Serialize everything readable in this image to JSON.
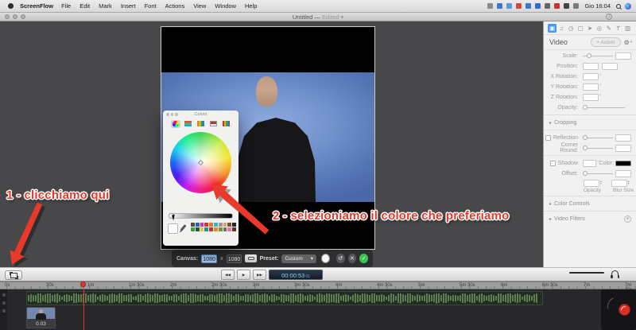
{
  "menu_bar": {
    "app_name": "ScreenFlow",
    "items": [
      "File",
      "Edit",
      "Mark",
      "Insert",
      "Font",
      "Actions",
      "View",
      "Window",
      "Help"
    ],
    "clock": "Gio 16:04",
    "status_icon_colors": [
      "#8a8a8a",
      "#3e77c9",
      "#5b9bd5",
      "#c94a3e",
      "#3e77c9",
      "#2f6fd0",
      "#666666",
      "#c0392b",
      "#444444",
      "#7a7a7a"
    ]
  },
  "title_bar": {
    "title": "Untitled —",
    "edited": "Edited"
  },
  "annotations": {
    "step1": "1 - clicchiamo qui",
    "step2": "2 - selezioniamo il colore che preferiamo"
  },
  "colors_panel": {
    "title": "Colors",
    "swatches_row1": [
      "#4d4d4d",
      "#2f5bb7",
      "#c23b9e",
      "#d63333",
      "#e2762d",
      "#39b3c8",
      "#9a9a9a",
      "#c8a87a",
      "#7a5236",
      "#262626"
    ],
    "swatches_row2": [
      "#3f9a42",
      "#1f5c2e",
      "#d8c93a",
      "#2e8b8b",
      "#b33636",
      "#d88c2e",
      "#8a8a2e",
      "#6f6f6f",
      "#d87ea8",
      "#5c2e2e"
    ]
  },
  "canvas_bar": {
    "canvas_label": "Canvas:",
    "width": "1080",
    "x_sep": "x",
    "height": "1080",
    "preset_label": "Preset:",
    "preset_value": "Custom"
  },
  "transport": {
    "time": "00:00:53",
    "frames": "01"
  },
  "sidebar": {
    "header": {
      "title": "Video",
      "action": "+ Action"
    },
    "rows": {
      "scale": "Scale:",
      "position": "Position:",
      "x_rotation": "X Rotation:",
      "y_rotation": "Y Rotation:",
      "z_rotation": "Z Rotation:",
      "opacity": "Opacity:",
      "cropping": "Cropping",
      "reflection": "Reflection",
      "corner_round": "Corner Round:",
      "shadow": "Shadow",
      "color": "Color:",
      "offset": "Offset:",
      "opacity_small": "Opacity",
      "blur_size": "Blur Size",
      "color_controls": "Color Controls",
      "video_filters": "Video Filters"
    },
    "degree": "°"
  },
  "timeline": {
    "ruler_labels": [
      "0s",
      "30s",
      "1m",
      "1m 30s",
      "2m",
      "2m 30s",
      "3m",
      "3m 30s",
      "4m",
      "4m 30s",
      "5m",
      "5m 30s",
      "6m",
      "6m 30s",
      "7m",
      "7m 30s"
    ],
    "clip_duration": "0.03"
  },
  "icons": {
    "video_tab": "▣",
    "audio_tab": "♫",
    "motion_tab": "◷",
    "screen_tab": "▢",
    "pointer_tab": "➤",
    "touch_tab": "◎",
    "annotation_tab": "✎",
    "text_tab": "T",
    "media_tab": "▥",
    "gear": "⚙",
    "dropdown_caret": "▾",
    "disclosure": "▸",
    "plus": "+",
    "info": "i",
    "rewind": "◀◀",
    "play": "▶",
    "forward": "▶▶",
    "reset": "↺",
    "cancel": "✕",
    "confirm": "✓",
    "stepper_up": "▴",
    "stepper_down": "▾"
  },
  "accent_colors": {
    "annotation_red": "#e23b2c",
    "confirm_green": "#3dc453",
    "selection_blue": "#3f9bf4",
    "playhead_red": "#e03a30"
  }
}
